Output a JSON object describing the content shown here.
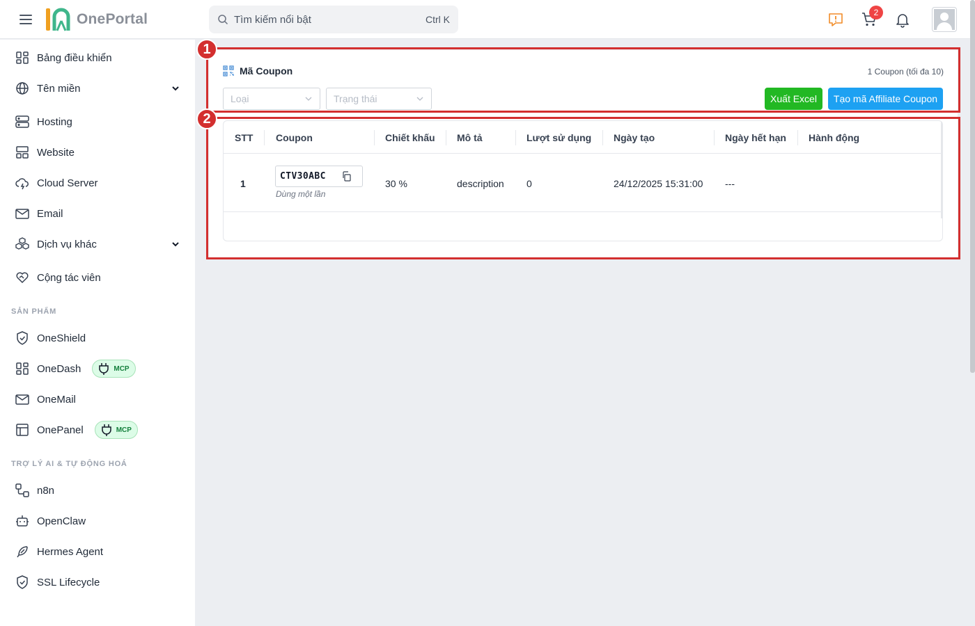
{
  "header": {
    "logo_text": "OnePortal",
    "search_placeholder": "Tìm kiếm nổi bật",
    "search_shortcut": "Ctrl K",
    "cart_count": "2"
  },
  "sidebar": {
    "items": [
      {
        "label": "Bảng điều khiển",
        "icon": "dashboard-icon"
      },
      {
        "label": "Tên miền",
        "icon": "globe-icon"
      },
      {
        "label": "Hosting",
        "icon": "server-icon"
      },
      {
        "label": "Website",
        "icon": "website-icon"
      },
      {
        "label": "Cloud Server",
        "icon": "cloud-icon"
      },
      {
        "label": "Email",
        "icon": "mail-icon"
      },
      {
        "label": "Dịch vụ khác",
        "icon": "boxes-icon"
      },
      {
        "label": "Cộng tác viên",
        "icon": "heart-handshake-icon"
      }
    ],
    "products_title": "SẢN PHẨM",
    "products": [
      {
        "label": "OneShield",
        "icon": "shield-icon"
      },
      {
        "label": "OneDash",
        "icon": "dashboard-icon",
        "badge": "MCP"
      },
      {
        "label": "OneMail",
        "icon": "mail-icon"
      },
      {
        "label": "OnePanel",
        "icon": "panel-icon",
        "badge": "MCP"
      }
    ],
    "ai_title": "TRỢ LÝ AI & TỰ ĐỘNG HOÁ",
    "ai": [
      {
        "label": "n8n",
        "icon": "workflow-icon"
      },
      {
        "label": "OpenClaw",
        "icon": "bot-icon"
      },
      {
        "label": "Hermes Agent",
        "icon": "feather-icon"
      },
      {
        "label": "SSL Lifecycle",
        "icon": "shield-check-icon"
      }
    ]
  },
  "annotations": [
    "1",
    "2"
  ],
  "coupon_card": {
    "title": "Mã Coupon",
    "count_text": "1 Coupon (tối đa 10)",
    "filter_type_placeholder": "Loại",
    "filter_status_placeholder": "Trạng thái",
    "export_button": "Xuất Excel",
    "create_button": "Tạo mã Affiliate Coupon"
  },
  "table": {
    "columns": [
      "STT",
      "Coupon",
      "Chiết khấu",
      "Mô tả",
      "Lượt sử dụng",
      "Ngày tạo",
      "Ngày hết hạn",
      "Hành động"
    ],
    "rows": [
      {
        "stt": "1",
        "coupon": "CTV30ABC",
        "coupon_note": "Dùng một lần",
        "discount": "30 %",
        "description": "description",
        "usage": "0",
        "created": "24/12/2025 15:31:00",
        "expires": "---",
        "actions": ""
      }
    ]
  },
  "colors": {
    "accent_red": "#d32f2f",
    "export_green": "#22b823",
    "create_blue": "#1da1f2",
    "mcp_green": "#15803d"
  }
}
